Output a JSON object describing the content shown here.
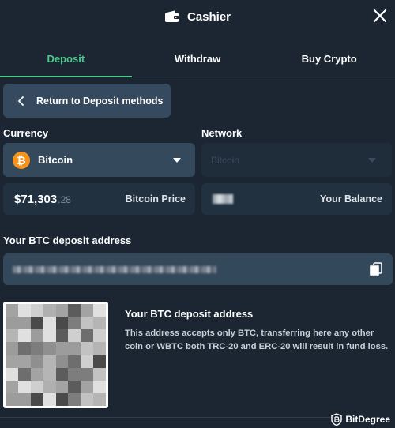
{
  "header": {
    "title": "Cashier"
  },
  "tabs": [
    {
      "label": "Deposit",
      "active": true
    },
    {
      "label": "Withdraw",
      "active": false
    },
    {
      "label": "Buy Crypto",
      "active": false
    }
  ],
  "back_button": {
    "label": "Return to Deposit methods"
  },
  "currency": {
    "label": "Currency",
    "selected": "Bitcoin",
    "icon": "bitcoin-icon",
    "icon_glyph": "₿"
  },
  "network": {
    "label": "Network",
    "selected": "Bitcoin"
  },
  "price": {
    "whole": "$71,303",
    "decimals": ".28",
    "label": "Bitcoin Price"
  },
  "balance": {
    "label": "Your Balance"
  },
  "deposit_address": {
    "label": "Your BTC deposit address"
  },
  "info": {
    "title": "Your BTC deposit address",
    "text": "This address accepts only BTC, transferring here any other coin or WBTC both TRC-20 and ERC-20 will result in fund loss."
  },
  "brand": {
    "name": "BitDegree"
  },
  "colors": {
    "background": "#1b2632",
    "accent": "#4cc98b",
    "panel": "#34485b",
    "bitcoin": "#f7931a"
  }
}
